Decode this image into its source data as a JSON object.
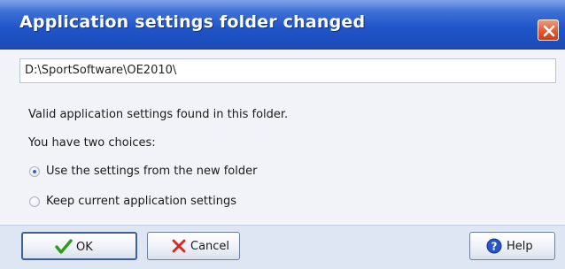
{
  "dialog": {
    "title": "Application settings folder changed",
    "folder_path": "D:\\SportSoftware\\OE2010\\",
    "message": "Valid application settings found in this folder.",
    "prompt": "You have two choices:",
    "options": [
      {
        "label": "Use the settings from the new folder",
        "selected": true
      },
      {
        "label": "Keep current application settings",
        "selected": false
      }
    ]
  },
  "buttons": {
    "ok": "OK",
    "cancel": "Cancel",
    "help": "Help"
  },
  "icons": {
    "close": "close-icon",
    "ok": "checkmark-icon",
    "cancel": "cross-icon",
    "help": "help-icon"
  },
  "colors": {
    "titlebar": "#1f54c9",
    "close_button": "#e2552c",
    "ok_check": "#2e9a1e",
    "cancel_cross": "#d8261c",
    "help_icon": "#2a55c4"
  }
}
